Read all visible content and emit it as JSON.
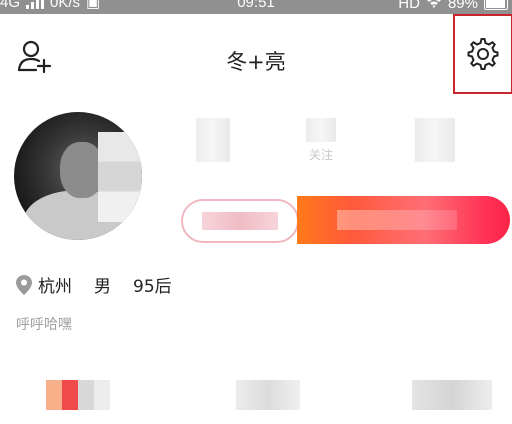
{
  "status_bar": {
    "network": "4G",
    "speed": "0K/s",
    "time": "09:51",
    "hd": "HD",
    "battery": "89%"
  },
  "header": {
    "title": "冬+亮"
  },
  "profile": {
    "stat_label": "关注",
    "location": "杭州",
    "gender": "男",
    "age": "95后",
    "bio": "呼呼哈嘿"
  },
  "colors": {
    "accent": "#ff2448",
    "highlight_border": "#c8252c"
  },
  "icons": {
    "add_user": "add-user-icon",
    "settings": "gear-icon",
    "location": "location-pin-icon"
  }
}
